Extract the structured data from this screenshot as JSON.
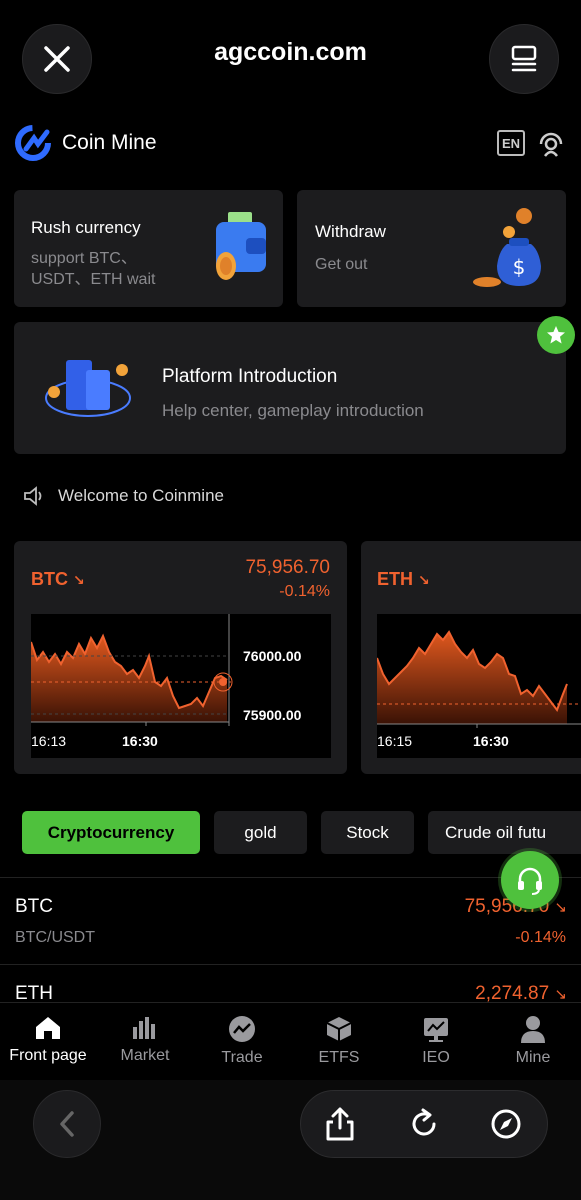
{
  "browser": {
    "url": "agccoin.com"
  },
  "header": {
    "brand": "Coin Mine",
    "lang": "EN"
  },
  "cards": {
    "rush": {
      "title": "Rush currency",
      "sub_line1": "support BTC、",
      "sub_line2": "USDT、ETH wait"
    },
    "withdraw": {
      "title": "Withdraw",
      "sub": "Get out"
    },
    "platform": {
      "title": "Platform Introduction",
      "sub": "Help center, gameplay introduction"
    }
  },
  "notice": {
    "text": "Welcome to Coinmine"
  },
  "tickers": [
    {
      "symbol": "BTC",
      "price": "75,956.70",
      "change": "-0.14%",
      "y_top": "76000.00",
      "y_bottom": "75900.00",
      "x_start": "16:13",
      "x_mid": "16:30"
    },
    {
      "symbol": "ETH",
      "x_start": "16:15",
      "x_mid": "16:30"
    }
  ],
  "tabs": [
    "Cryptocurrency",
    "gold",
    "Stock",
    "Crude oil futu"
  ],
  "market_rows": [
    {
      "symbol": "BTC",
      "pair": "BTC/USDT",
      "price": "75,956.70",
      "change": "-0.14%"
    },
    {
      "symbol": "ETH",
      "price": "2,274.87"
    }
  ],
  "nav": [
    "Front page",
    "Market",
    "Trade",
    "ETFS",
    "IEO",
    "Mine"
  ],
  "colors": {
    "accent_green": "#4fc13d",
    "down_red": "#f0622f",
    "card_bg": "#1c1c1e",
    "brand_blue": "#2f6bff"
  }
}
